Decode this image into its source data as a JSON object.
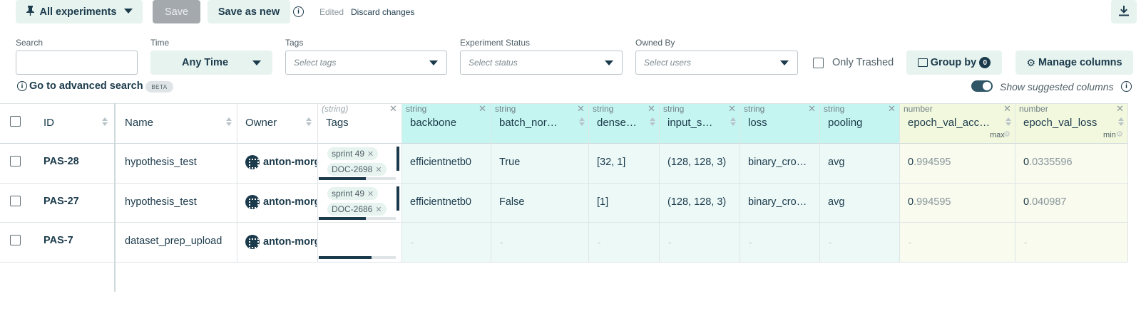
{
  "toolbar": {
    "view_label": "All experiments",
    "save_label": "Save",
    "save_as_new_label": "Save as new",
    "edited_label": "Edited",
    "discard_label": "Discard changes"
  },
  "filters": {
    "search_label": "Search",
    "search_value": "",
    "time_label": "Time",
    "time_value": "Any Time",
    "tags_label": "Tags",
    "tags_placeholder": "Select tags",
    "status_label": "Experiment Status",
    "status_placeholder": "Select status",
    "owner_label": "Owned By",
    "owner_placeholder": "Select users",
    "only_trashed_label": "Only Trashed",
    "group_by_label": "Group by",
    "group_by_count": "0",
    "manage_columns_label": "Manage columns",
    "advanced_search_label": "Go to advanced search",
    "beta_badge": "BETA",
    "show_suggested_label": "Show suggested columns"
  },
  "columns": {
    "id": "ID",
    "name": "Name",
    "owner": "Owner",
    "tags": {
      "type": "(string)",
      "label": "Tags"
    },
    "backbone": {
      "type": "string",
      "label": "backbone"
    },
    "batch_norm": {
      "type": "string",
      "label": "batch_nor…"
    },
    "dense": {
      "type": "string",
      "label": "dense…"
    },
    "input_shape": {
      "type": "string",
      "label": "input_s…"
    },
    "loss": {
      "type": "string",
      "label": "loss"
    },
    "pooling": {
      "type": "string",
      "label": "pooling"
    },
    "epoch_val_acc": {
      "type": "number",
      "label": "epoch_val_acc…",
      "agg": "max"
    },
    "epoch_val_loss": {
      "type": "number",
      "label": "epoch_val_loss",
      "agg": "min"
    }
  },
  "rows": [
    {
      "id": "PAS-28",
      "name": "hypothesis_test",
      "owner": "anton-morg",
      "tags": [
        "sprint 49",
        "DOC-2698"
      ],
      "backbone": "efficientnetb0",
      "batch_norm": "True",
      "dense": "[32, 1]",
      "input_shape": "(128, 128, 3)",
      "loss": "binary_cro…",
      "pooling": "avg",
      "acc_int": "0",
      "acc_frac": ".994595",
      "loss_int": "0",
      "loss_frac": ".0335596"
    },
    {
      "id": "PAS-27",
      "name": "hypothesis_test",
      "owner": "anton-morg",
      "tags": [
        "sprint 49",
        "DOC-2686"
      ],
      "backbone": "efficientnetb0",
      "batch_norm": "False",
      "dense": "[1]",
      "input_shape": "(128, 128, 3)",
      "loss": "binary_cro…",
      "pooling": "avg",
      "acc_int": "0",
      "acc_frac": ".994595",
      "loss_int": "0",
      "loss_frac": ".040987"
    },
    {
      "id": "PAS-7",
      "name": "dataset_prep_upload",
      "owner": "anton-morg",
      "tags": [],
      "backbone": "-",
      "batch_norm": "-",
      "dense": "-",
      "input_shape": "-",
      "loss": "-",
      "pooling": "-",
      "acc_dash": "-",
      "loss_dash": "-"
    }
  ],
  "icons": {
    "pin": "pin-icon",
    "caret": "caret-down-icon",
    "info": "info-icon",
    "download": "download-icon",
    "gear": "gear-icon",
    "close": "close-icon",
    "sort": "sort-icon"
  },
  "colors": {
    "primary": "#1b3a4b",
    "soft_button": "#e6f3ef",
    "string_header": "#c5f5f0",
    "string_column": "#ecf9f7",
    "number_header": "#f2f8de",
    "number_column": "#f8fbee"
  }
}
